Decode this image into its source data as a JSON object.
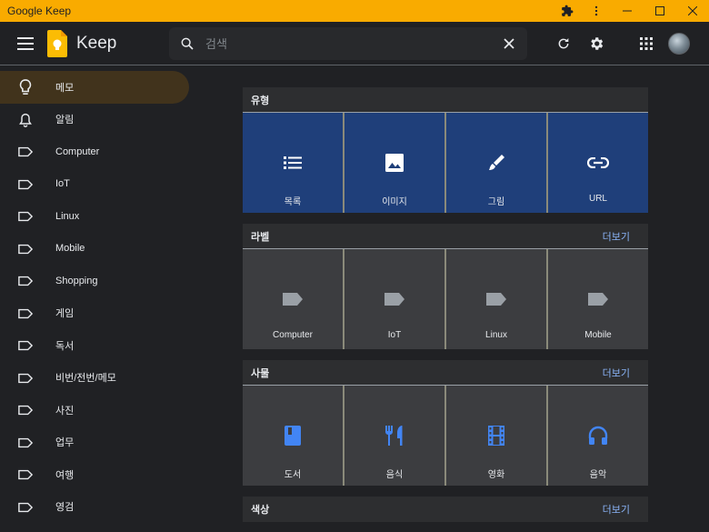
{
  "window": {
    "title": "Google Keep"
  },
  "header": {
    "app_name": "Keep",
    "search_placeholder": "검색"
  },
  "sidebar": {
    "items": [
      {
        "label": "메모",
        "icon": "lightbulb-icon",
        "active": true
      },
      {
        "label": "알림",
        "icon": "bell-icon"
      },
      {
        "label": "Computer",
        "icon": "label-icon"
      },
      {
        "label": "IoT",
        "icon": "label-icon"
      },
      {
        "label": "Linux",
        "icon": "label-icon"
      },
      {
        "label": "Mobile",
        "icon": "label-icon"
      },
      {
        "label": "Shopping",
        "icon": "label-icon"
      },
      {
        "label": "게임",
        "icon": "label-icon"
      },
      {
        "label": "독서",
        "icon": "label-icon"
      },
      {
        "label": "비번/전번/메모",
        "icon": "label-icon"
      },
      {
        "label": "사진",
        "icon": "label-icon"
      },
      {
        "label": "업무",
        "icon": "label-icon"
      },
      {
        "label": "여행",
        "icon": "label-icon"
      },
      {
        "label": "영검",
        "icon": "label-icon"
      }
    ]
  },
  "sections": {
    "type": {
      "title": "유형",
      "tiles": [
        {
          "label": "목록",
          "icon": "list-icon"
        },
        {
          "label": "이미지",
          "icon": "image-icon"
        },
        {
          "label": "그림",
          "icon": "brush-icon"
        },
        {
          "label": "URL",
          "icon": "link-icon"
        }
      ]
    },
    "labels": {
      "title": "라벨",
      "more": "더보기",
      "tiles": [
        {
          "label": "Computer",
          "icon": "label-icon"
        },
        {
          "label": "IoT",
          "icon": "label-icon"
        },
        {
          "label": "Linux",
          "icon": "label-icon"
        },
        {
          "label": "Mobile",
          "icon": "label-icon"
        }
      ]
    },
    "things": {
      "title": "사물",
      "more": "더보기",
      "tiles": [
        {
          "label": "도서",
          "icon": "book-icon"
        },
        {
          "label": "음식",
          "icon": "restaurant-icon"
        },
        {
          "label": "영화",
          "icon": "movie-icon"
        },
        {
          "label": "음악",
          "icon": "headphones-icon"
        }
      ]
    },
    "colors": {
      "title": "색상",
      "more": "더보기"
    }
  },
  "colors": {
    "accent_yellow": "#f9ab00",
    "link_blue": "#8ab4f8",
    "tile_blue": "#1f3f7a",
    "icon_blue": "#4285f4"
  }
}
